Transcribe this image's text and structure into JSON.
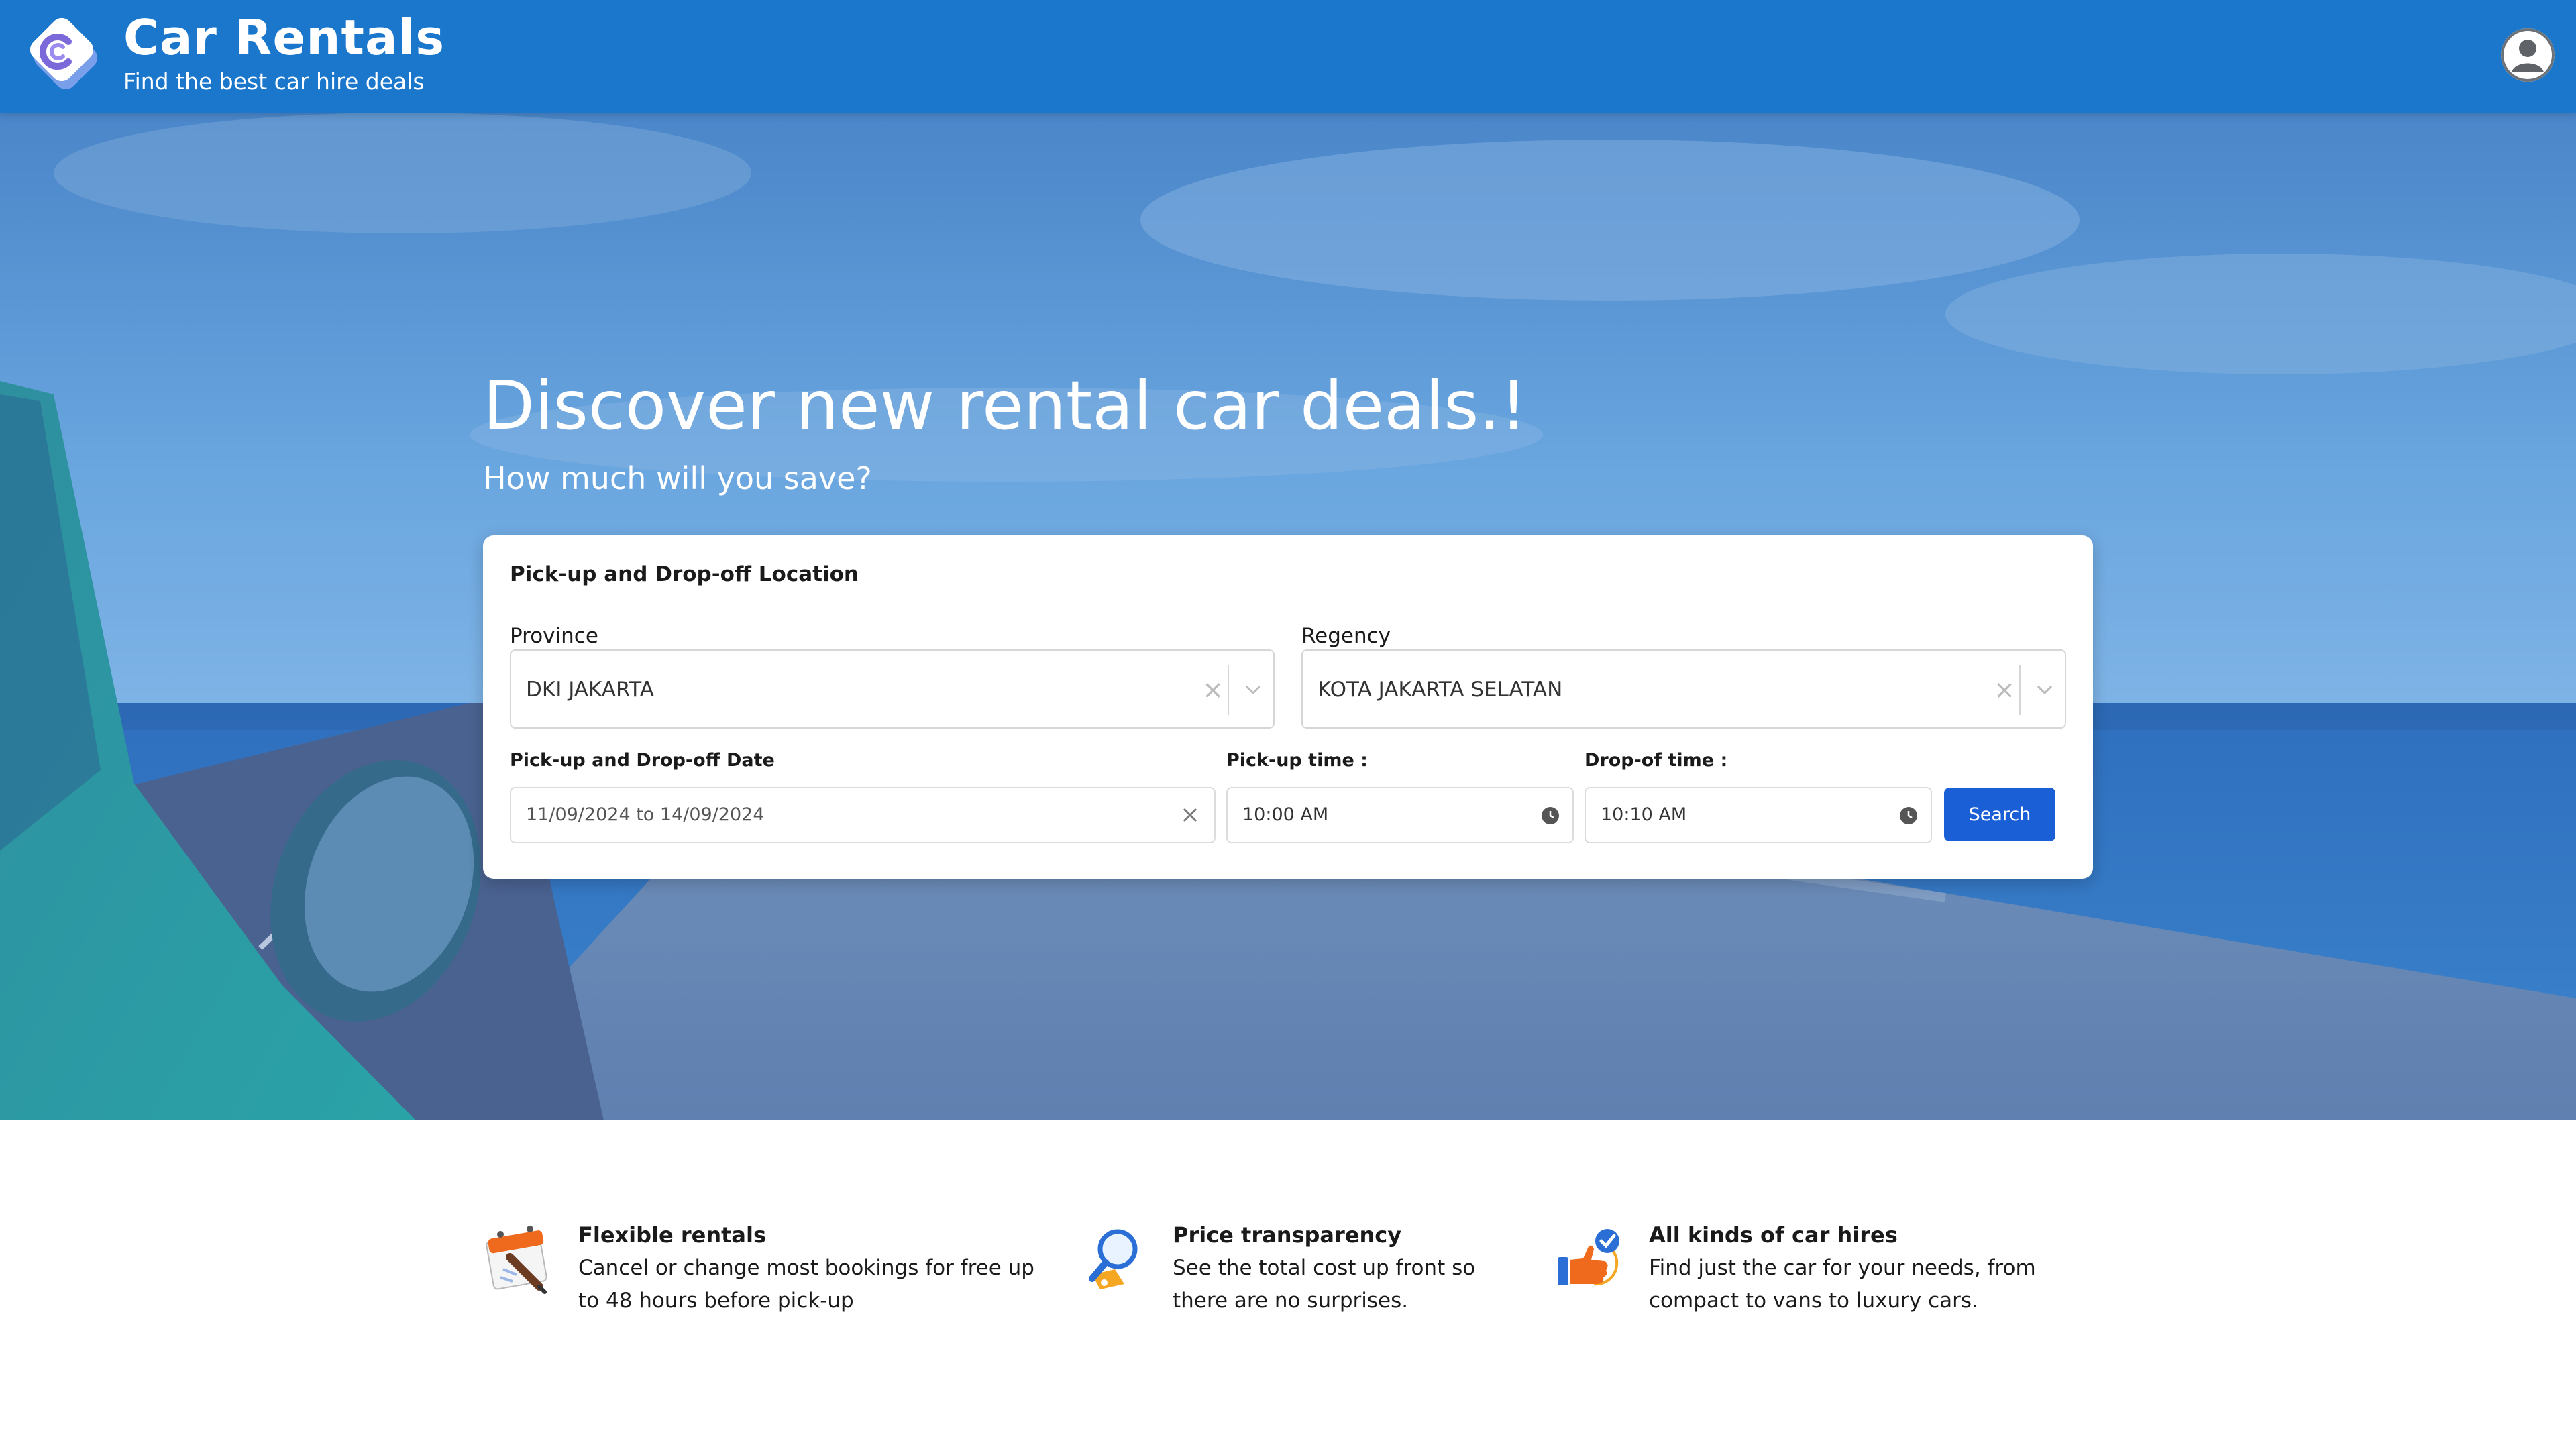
{
  "header": {
    "title": "Car Rentals",
    "subtitle": "Find the best car hire deals",
    "logo_icon": "car-rentals-logo",
    "avatar_icon": "user-avatar-icon",
    "color": "#1b77cc"
  },
  "hero": {
    "title": "Discover new rental car deals.!",
    "subtitle": "How much will you save?"
  },
  "search": {
    "heading": "Pick-up and Drop-off Location",
    "province": {
      "label": "Province",
      "value": "DKI JAKARTA"
    },
    "regency": {
      "label": "Regency",
      "value": "KOTA JAKARTA SELATAN"
    },
    "date": {
      "label": "Pick-up and Drop-off Date",
      "value": "11/09/2024 to 14/09/2024"
    },
    "pickup_time": {
      "label": "Pick-up time :",
      "value": "10:00 AM"
    },
    "dropoff_time": {
      "label": "Drop-of time :",
      "value": "10:10 AM"
    },
    "button_label": "Search",
    "button_color": "#1a5fd6"
  },
  "features": [
    {
      "title": "Flexible rentals",
      "desc_line1": "Cancel or change most bookings for free up",
      "desc_line2": "to 48 hours before pick-up",
      "icon": "calendar-pen-icon"
    },
    {
      "title": "Price transparency",
      "desc_line1": "See the total cost up front so",
      "desc_line2": "there are no surprises.",
      "icon": "magnifier-tag-icon"
    },
    {
      "title": "All kinds of car hires",
      "desc_line1": "Find just the car for your needs, from",
      "desc_line2": "compact to vans to luxury cars.",
      "icon": "thumbs-up-check-icon"
    }
  ]
}
